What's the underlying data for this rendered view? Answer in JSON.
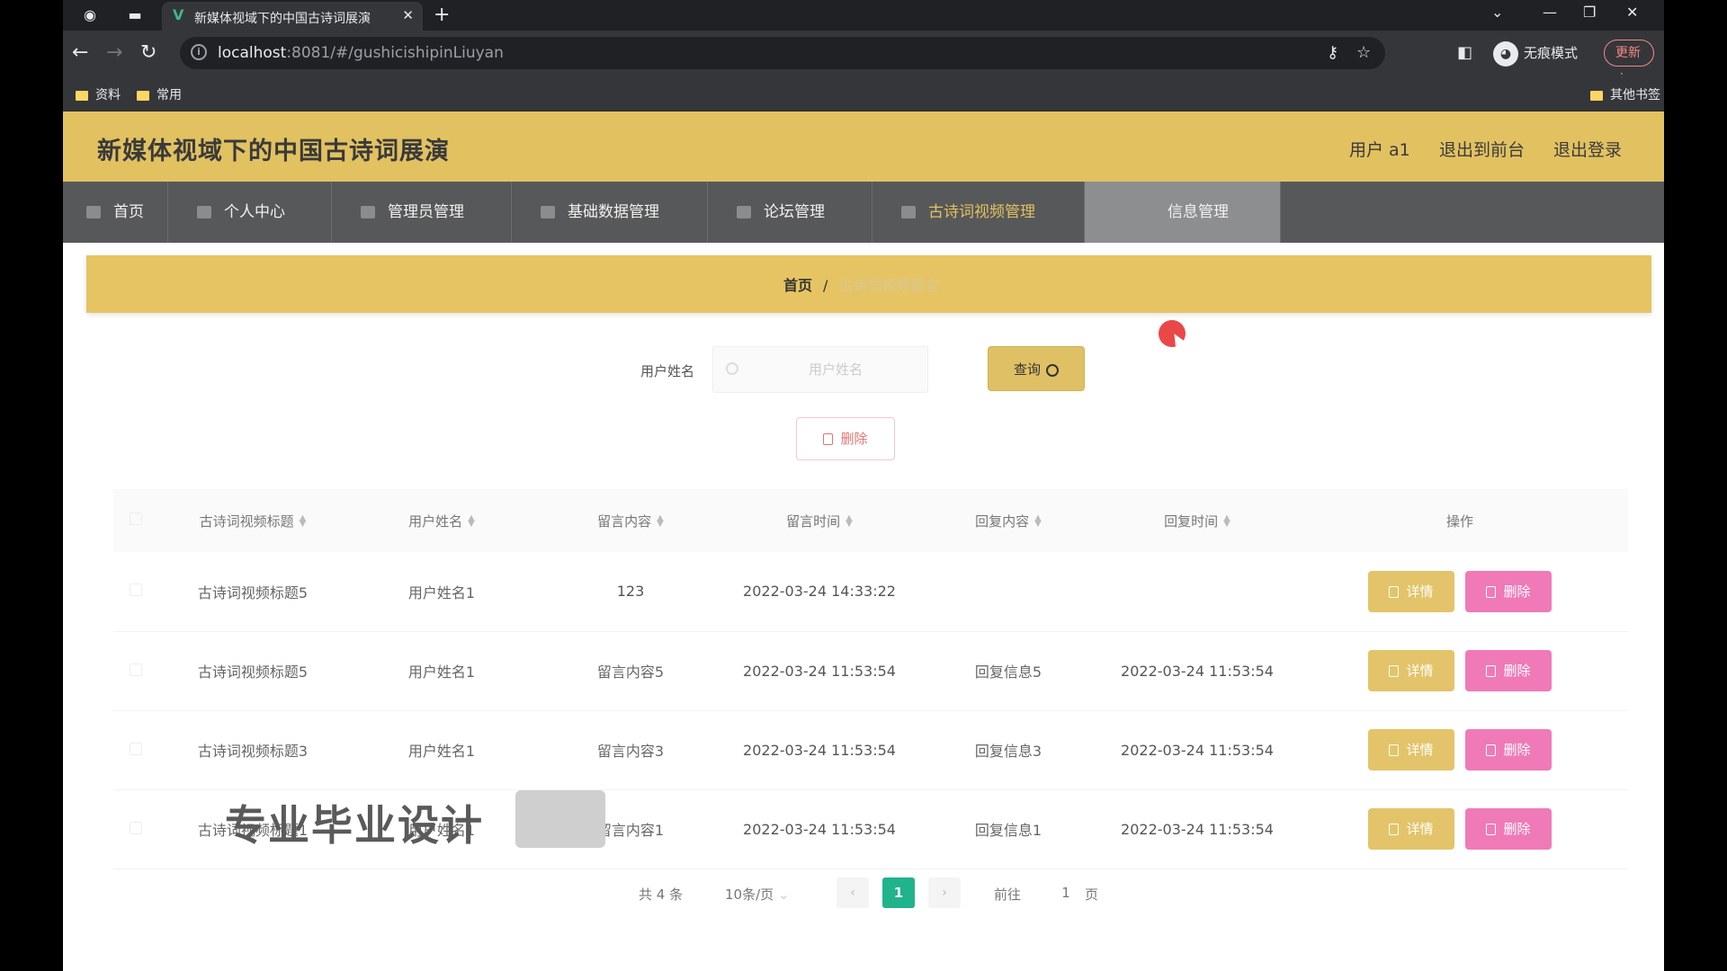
{
  "browser": {
    "tab_title": "新媒体视域下的中国古诗词展演",
    "url_host": "localhost",
    "url_rest": ":8081/#/gushicishipinLiuyan",
    "profile_label": "无痕模式",
    "update_label": "更新",
    "bookmarks": [
      "资料",
      "常用"
    ],
    "other_bookmarks": "其他书签"
  },
  "header": {
    "title": "新媒体视域下的中国古诗词展演",
    "user": "用户 a1",
    "to_front": "退出到前台",
    "logout": "退出登录"
  },
  "menu": [
    {
      "label": "首页"
    },
    {
      "label": "个人中心"
    },
    {
      "label": "管理员管理"
    },
    {
      "label": "基础数据管理"
    },
    {
      "label": "论坛管理"
    },
    {
      "label": "古诗词视频管理"
    },
    {
      "label": "信息管理"
    }
  ],
  "breadcrumb": {
    "home": "首页",
    "separator": "/",
    "current": "古诗词视频留言"
  },
  "search": {
    "label": "用户姓名",
    "placeholder": "用户姓名",
    "query_label": "查询"
  },
  "batch_delete_label": "删除",
  "table": {
    "columns": [
      "古诗词视频标题",
      "用户姓名",
      "留言内容",
      "留言时间",
      "回复内容",
      "回复时间",
      "操作"
    ],
    "rows": [
      {
        "title": "古诗词视频标题5",
        "user": "用户姓名1",
        "content": "123",
        "time": "2022-03-24 14:33:22",
        "reply": "",
        "reply_time": ""
      },
      {
        "title": "古诗词视频标题5",
        "user": "用户姓名1",
        "content": "留言内容5",
        "time": "2022-03-24 11:53:54",
        "reply": "回复信息5",
        "reply_time": "2022-03-24 11:53:54"
      },
      {
        "title": "古诗词视频标题3",
        "user": "用户姓名1",
        "content": "留言内容3",
        "time": "2022-03-24 11:53:54",
        "reply": "回复信息3",
        "reply_time": "2022-03-24 11:53:54"
      },
      {
        "title": "古诗词视频标题1",
        "user": "用户姓名1",
        "content": "留言内容1",
        "time": "2022-03-24 11:53:54",
        "reply": "回复信息1",
        "reply_time": "2022-03-24 11:53:54"
      }
    ],
    "detail_label": "详情",
    "delete_label": "删除"
  },
  "pagination": {
    "total": "共 4 条",
    "page_size": "10条/页",
    "current_page": "1",
    "goto_label": "前往",
    "goto_value": "1",
    "page_unit": "页"
  },
  "watermark": "专业毕业设计"
}
